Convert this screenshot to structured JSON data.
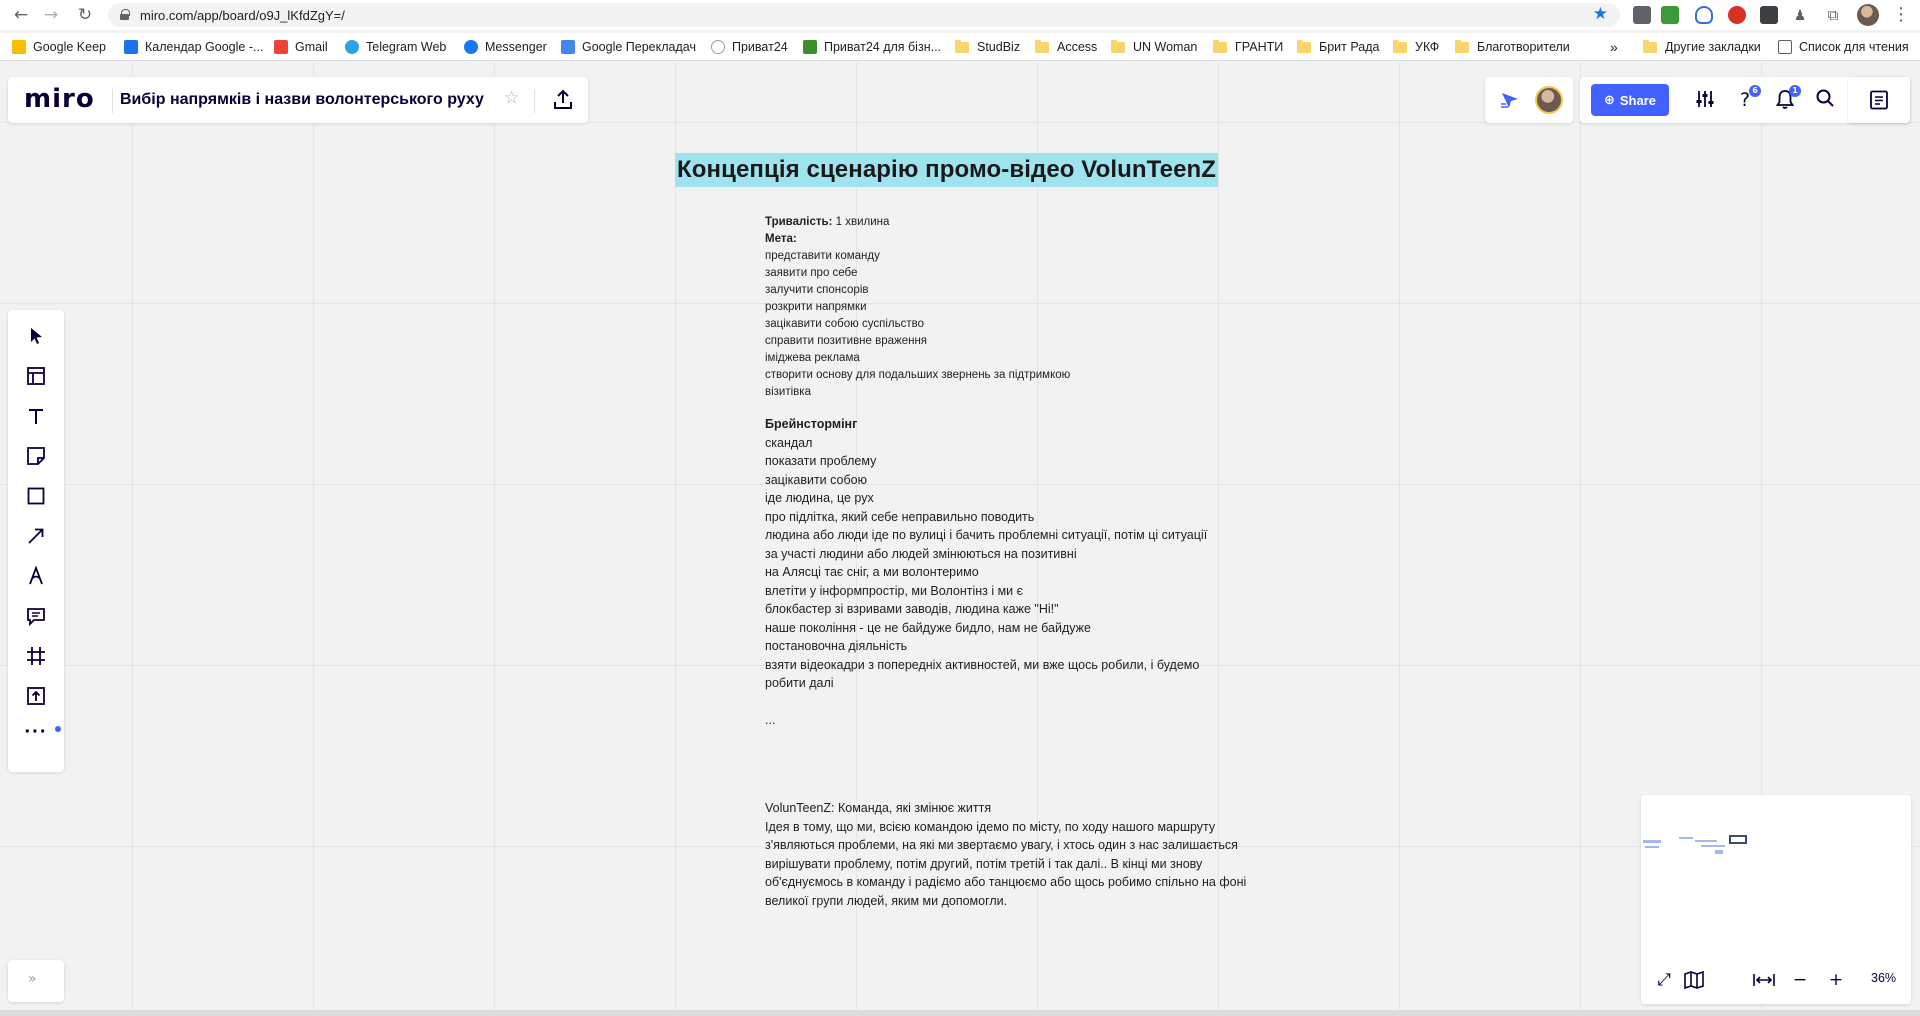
{
  "browser": {
    "url": "miro.com/app/board/o9J_lKfdZgY=/",
    "bookmarks": [
      "Google Keep",
      "Календар Google -...",
      "Gmail",
      "Telegram Web",
      "Messenger",
      "Google Перекладач",
      "Приват24",
      "Приват24 для бізн...",
      "StudBiz",
      "Access",
      "UN Woman",
      "ГРАНТИ",
      "Брит Рада",
      "УКФ",
      "Благотворители"
    ],
    "overflow_label": "»",
    "other_bookmarks": "Другие закладки",
    "reading_list": "Список для чтения"
  },
  "app": {
    "logo": "miro",
    "board_title": "Вибір напрямків і назви волонтерського руху",
    "share_label": "Share",
    "help_badge": "6",
    "notif_badge": "1",
    "zoom": "36%",
    "accent": "#4262ff"
  },
  "content": {
    "title": "Концепція сценарію промо-відео VolunTeenZ",
    "duration_label": "Тривалість:",
    "duration_value": " 1 хвилина",
    "goal_label": "Мета:",
    "goals": [
      "представити команду",
      "заявити про себе",
      "залучити спонсорів",
      "розкрити напрямки",
      "зацікавити собою суспільство",
      "справити позитивне враження",
      "іміджева реклама",
      "створити основу для подальших звернень за підтримкою",
      "візитівка"
    ],
    "brainstorm_label": "Брейнстормінг",
    "brainstorm": [
      "скандал",
      "показати проблему",
      "зацікавити собою",
      "іде людина, це рух",
      "про підлітка, який себе неправильно поводить",
      "людина або люди іде по вулиці і бачить проблемні ситуації, потім ці ситуації",
      "за участі людини або людей змінюються на позитивні",
      "на Алясці тає сніг, а ми волонтеримо",
      "влетіти у інформпростір, ми Волонтінз і ми є",
      "блокбастер зі взривами заводів, людина каже \"Ні!\"",
      "наше покоління - це не байдуже бидло, нам не байдуже",
      "постановочна діяльність",
      "взяти відеокадри з попередніх активностей, ми вже щось робили, і будемо",
      "робити далі"
    ],
    "ellipsis": "...",
    "concept_title": "VolunTeenZ: Команда, які змінює життя",
    "concept_lines": [
      "Ідея в тому, що ми, всією командою ідемо по місту, по ходу нашого маршруту",
      "з'являються проблеми, на які ми звертаємо увагу, і хтось один з нас залишається",
      "вирішувати проблему, потім другий, потім третій і так далі.. В кінці ми знову",
      "об'єднуємось в команду і радіємо або танцюємо або щось робимо спільно на фоні",
      "великої групи людей, яким ми допомогли."
    ]
  }
}
